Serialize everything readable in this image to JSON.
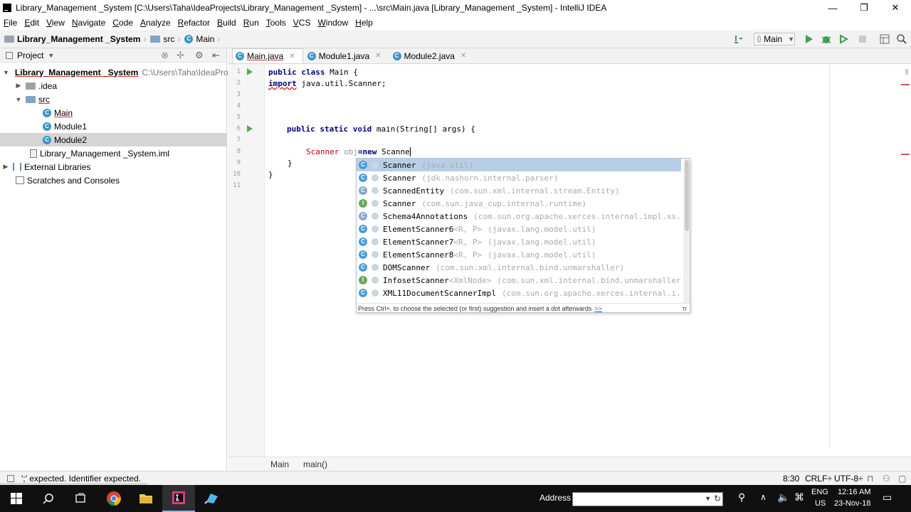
{
  "window": {
    "title": "Library_Management _System [C:\\Users\\Taha\\IdeaProjects\\Library_Management _System] - ...\\src\\Main.java [Library_Management _System] - IntelliJ IDEA",
    "controls": {
      "minimize": "—",
      "restore": "❐",
      "close": "✕"
    }
  },
  "menu": [
    "File",
    "Edit",
    "View",
    "Navigate",
    "Code",
    "Analyze",
    "Refactor",
    "Build",
    "Run",
    "Tools",
    "VCS",
    "Window",
    "Help"
  ],
  "breadcrumb": {
    "project": "Library_Management _System",
    "folder": "src",
    "file": "Main"
  },
  "run_config": {
    "label": "Main"
  },
  "project_panel": {
    "title": "Project",
    "items": [
      {
        "label": "Library_Management _System",
        "path": "C:\\Users\\Taha\\IdeaProje"
      },
      {
        "label": ".idea"
      },
      {
        "label": "src"
      },
      {
        "label": "Main"
      },
      {
        "label": "Module1"
      },
      {
        "label": "Module2"
      },
      {
        "label": "Library_Management _System.iml"
      },
      {
        "label": "External Libraries"
      },
      {
        "label": "Scratches and Consoles"
      }
    ]
  },
  "tabs": [
    {
      "label": "Main.java"
    },
    {
      "label": "Module1.java"
    },
    {
      "label": "Module2.java"
    }
  ],
  "code": {
    "line_numbers": [
      "1",
      "2",
      "3",
      "4",
      "5",
      "6",
      "7",
      "8",
      "9",
      "10",
      "11"
    ],
    "l1_kw": "public class",
    "l1_rest": " Main {",
    "l2_kw": "import",
    "l2_rest": " java.util.Scanner;",
    "l6_kw": "public static void",
    "l6_rest": " main(String[] args) {",
    "l8_a": "Scanner",
    "l8_b": " obj",
    "l8_c": "=new",
    "l8_d": " Scanne",
    "l9": "}",
    "l10": "}"
  },
  "completion": {
    "items": [
      {
        "m": "Scanner",
        "pkg": "(java.util)"
      },
      {
        "m": "Scanner",
        "pkg": "(jdk.nashorn.internal.parser)"
      },
      {
        "m": "ScannedEntity",
        "pkg": "(com.sun.xml.internal.stream.Entity)"
      },
      {
        "m": "Scanner",
        "pkg": "(com.sun.java_cup.internal.runtime)"
      },
      {
        "m": "Schema4Annotations",
        "pkg": "(com.sun.org.apache.xerces.internal.impl.xs..."
      },
      {
        "m": "ElementScanner6",
        "tp": "<R, P>",
        "pkg": "(javax.lang.model.util)"
      },
      {
        "m": "ElementScanner7",
        "tp": "<R, P>",
        "pkg": "(javax.lang.model.util)"
      },
      {
        "m": "ElementScanner8",
        "tp": "<R, P>",
        "pkg": "(javax.lang.model.util)"
      },
      {
        "m": "DOMScanner",
        "pkg": "(com.sun.xml.internal.bind.unmarshaller)"
      },
      {
        "m": "InfosetScanner",
        "tp": "<XmlNode>",
        "pkg": "(com.sun.xml.internal.bind.unmarshaller)"
      },
      {
        "m": "XML11DocumentScannerImpl",
        "pkg": "(com.sun.org.apache.xerces.internal.i..."
      }
    ],
    "hint": "Press Ctrl+. to choose the selected (or first) suggestion and insert a dot afterwards",
    "hint_link": ">>",
    "pi": "π"
  },
  "editor_breadcrumb": [
    "Main",
    "main()"
  ],
  "status": {
    "message": "';' expected. Identifier expected.",
    "position": "8:30",
    "line_sep": "CRLF÷",
    "encoding": "UTF-8÷"
  },
  "taskbar": {
    "address_label": "Address",
    "lang": "ENG",
    "region": "US",
    "time": "12:16 AM",
    "date": "23-Nov-18"
  }
}
